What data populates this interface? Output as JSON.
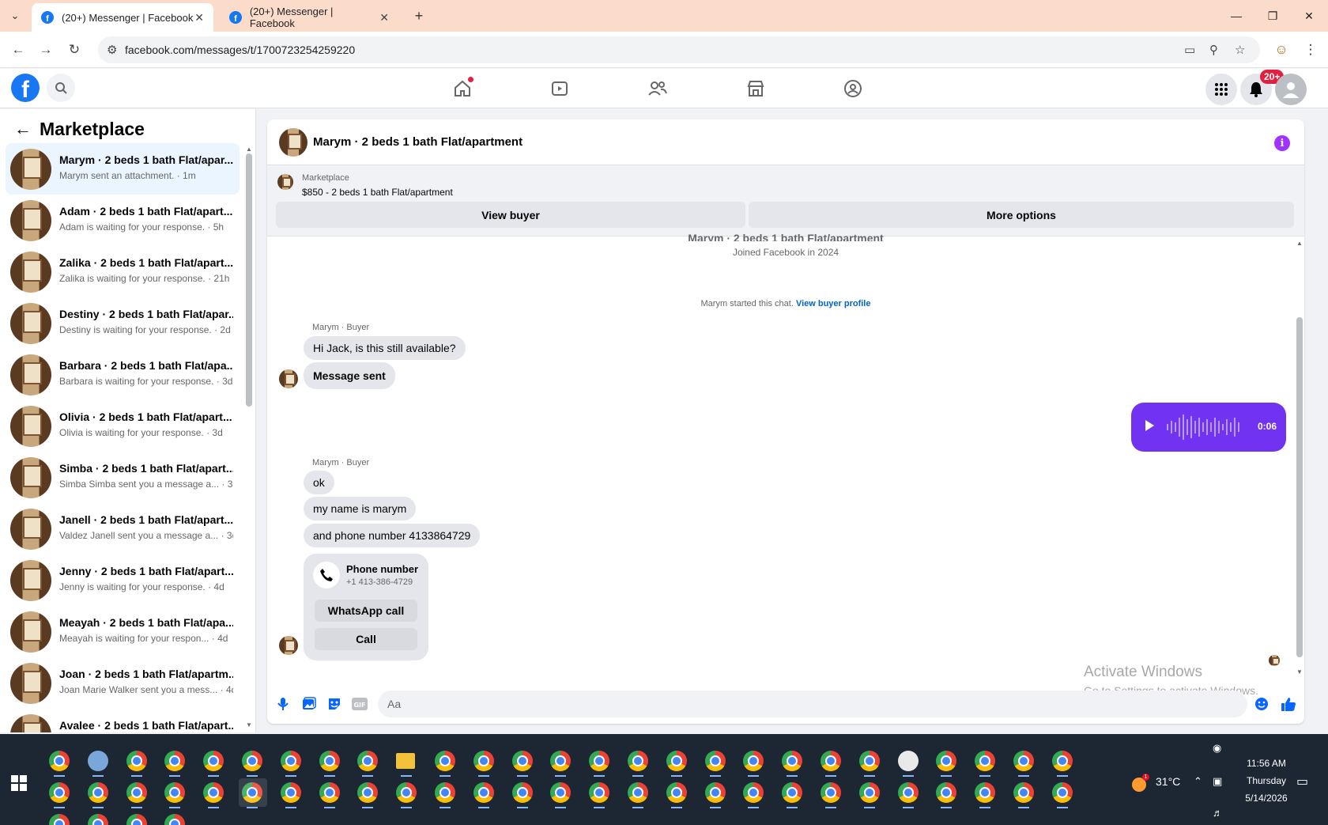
{
  "browser": {
    "tabs": [
      {
        "title": "(20+) Messenger | Facebook",
        "active": true
      },
      {
        "title": "(20+) Messenger | Facebook",
        "active": false
      }
    ],
    "url": "facebook.com/messages/t/1700723254259220"
  },
  "header": {
    "logo": "f",
    "notification_badge": "20+"
  },
  "sidebar": {
    "title": "Marketplace",
    "conversations": [
      {
        "name": "Marym · 2 beds 1 bath Flat/apar...",
        "preview": "Marym sent an attachment. · 1m",
        "active": true
      },
      {
        "name": "Adam · 2 beds 1 bath Flat/apart...",
        "preview": "Adam is waiting for your response. · 5h"
      },
      {
        "name": "Zalika · 2 beds 1 bath Flat/apart...",
        "preview": "Zalika is waiting for your response. · 21h"
      },
      {
        "name": "Destiny · 2 beds 1 bath Flat/apar...",
        "preview": "Destiny is waiting for your response. · 2d"
      },
      {
        "name": "Barbara · 2 beds 1 bath Flat/apa...",
        "preview": "Barbara is waiting for your response. · 3d"
      },
      {
        "name": "Olivia · 2 beds 1 bath Flat/apart...",
        "preview": "Olivia is waiting for your response. · 3d"
      },
      {
        "name": "Simba · 2 beds 1 bath Flat/apart...",
        "preview": "Simba Simba sent you a message a... · 3d"
      },
      {
        "name": "Janell · 2 beds 1 bath Flat/apart...",
        "preview": "Valdez Janell sent you a message a... · 3d"
      },
      {
        "name": "Jenny · 2 beds 1 bath Flat/apart...",
        "preview": "Jenny is waiting for your response. · 4d"
      },
      {
        "name": "Meayah · 2 beds 1 bath Flat/apa...",
        "preview": "Meayah is waiting for your respon... · 4d"
      },
      {
        "name": "Joan · 2 beds 1 bath Flat/apartm...",
        "preview": "Joan Marie Walker sent you a mess... · 4d"
      },
      {
        "name": "Avalee · 2 beds 1 bath Flat/apart...",
        "preview": ""
      }
    ]
  },
  "chat": {
    "title": "Marym · 2 beds 1 bath Flat/apartment",
    "info_icon": "i",
    "listing": {
      "source": "Marketplace",
      "price_line": "$850 - 2 beds 1 bath Flat/apartment",
      "view_buyer": "View buyer",
      "more_options": "More options"
    },
    "intro_heading": "Marym · 2 beds 1 bath Flat/apartment",
    "joined": "Joined Facebook in 2024",
    "started_text": "Marym started this chat.",
    "started_link": "View buyer profile",
    "sender_label": "Marym · Buyer",
    "group1": [
      "Hi Jack, is this still available?",
      "Message sent"
    ],
    "voice_duration": "0:06",
    "group2": [
      "ok",
      "my name is marym",
      "and phone number 4133864729"
    ],
    "phone_card": {
      "title": "Phone number",
      "number": "+1 413-386-4729",
      "whatsapp": "WhatsApp call",
      "call": "Call"
    },
    "composer_placeholder": "Aa"
  },
  "watermark": {
    "line1": "Activate Windows",
    "line2": "Go to Settings to activate Windows."
  },
  "taskbar": {
    "temperature": "31°C",
    "weather_badge": "1",
    "time": "11:56 AM",
    "day": "Thursday",
    "date": "5/14/2026"
  }
}
